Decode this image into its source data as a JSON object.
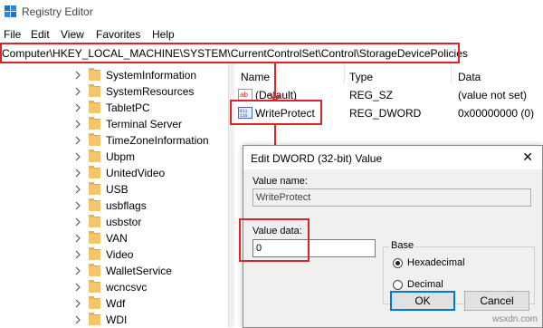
{
  "window": {
    "title": "Registry Editor",
    "icon": "registry-editor-icon"
  },
  "menu": [
    "File",
    "Edit",
    "View",
    "Favorites",
    "Help"
  ],
  "address": "Computer\\HKEY_LOCAL_MACHINE\\SYSTEM\\CurrentControlSet\\Control\\StorageDevicePolicies",
  "tree": {
    "items": [
      {
        "label": "SystemInformation"
      },
      {
        "label": "SystemResources"
      },
      {
        "label": "TabletPC"
      },
      {
        "label": "Terminal Server"
      },
      {
        "label": "TimeZoneInformation"
      },
      {
        "label": "Ubpm"
      },
      {
        "label": "UnitedVideo"
      },
      {
        "label": "USB"
      },
      {
        "label": "usbflags"
      },
      {
        "label": "usbstor"
      },
      {
        "label": "VAN"
      },
      {
        "label": "Video"
      },
      {
        "label": "WalletService"
      },
      {
        "label": "wcncsvc"
      },
      {
        "label": "Wdf"
      },
      {
        "label": "WDI"
      }
    ]
  },
  "list": {
    "headers": {
      "name": "Name",
      "type": "Type",
      "data": "Data"
    },
    "rows": [
      {
        "name": "(Default)",
        "type": "REG_SZ",
        "data": "(value not set)",
        "icon": "string-value-icon"
      },
      {
        "name": "WriteProtect",
        "type": "REG_DWORD",
        "data": "0x00000000 (0)",
        "icon": "dword-value-icon"
      }
    ]
  },
  "dialog": {
    "title": "Edit DWORD (32-bit) Value",
    "value_name_label": "Value name:",
    "value_name": "WriteProtect",
    "value_data_label": "Value data:",
    "value_data": "0",
    "base_label": "Base",
    "base_options": [
      {
        "label": "Hexadecimal",
        "checked": true
      },
      {
        "label": "Decimal",
        "checked": false
      }
    ],
    "ok_label": "OK",
    "cancel_label": "Cancel"
  },
  "watermark": "wsxdn.com",
  "colors": {
    "highlight": "#d9252a",
    "folder": "#f5c56a",
    "accent": "#0078d7"
  }
}
